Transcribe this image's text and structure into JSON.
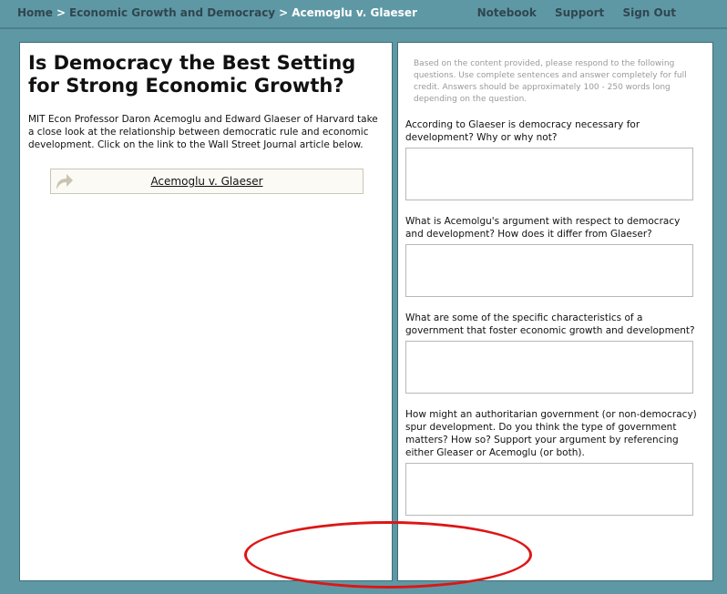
{
  "breadcrumb": {
    "home": "Home",
    "separator": ">",
    "section": "Economic Growth and Democracy",
    "current": "Acemoglu v. Glaeser"
  },
  "topnav": {
    "notebook": "Notebook",
    "support": "Support",
    "signout": "Sign Out"
  },
  "left_panel": {
    "title": "Is Democracy the Best Setting for Strong Economic Growth?",
    "intro": "MIT Econ Professor Daron Acemoglu and Edward Glaeser of Harvard take a close look at the relationship between democratic rule and economic development. Click on the link to the Wall Street Journal article below.",
    "link_label": "Acemoglu v. Glaeser",
    "link_icon": "curved-arrow-icon"
  },
  "right_panel": {
    "instructions": "Based on the content provided, please respond to the following questions. Use complete sentences and answer completely for full credit. Answers should be approximately 100 - 250 words long depending on the question.",
    "questions": [
      {
        "text": "According to Glaeser is democracy necessary for development? Why or why not?",
        "answer": ""
      },
      {
        "text": "What is Acemolgu's argument with respect to democracy and development? How does it differ from Glaeser?",
        "answer": ""
      },
      {
        "text": "What are some of the specific characteristics of a government that foster economic growth and development?",
        "answer": ""
      },
      {
        "text": "How might an authoritarian government (or non-democracy) spur development. Do you think the type of government matters? How so? Support your argument by referencing either Gleaser or Acemoglu (or both).",
        "answer": ""
      }
    ]
  },
  "colors": {
    "background": "#5f98a5",
    "nav_text": "#2f4650",
    "annotation": "#dd1616"
  }
}
